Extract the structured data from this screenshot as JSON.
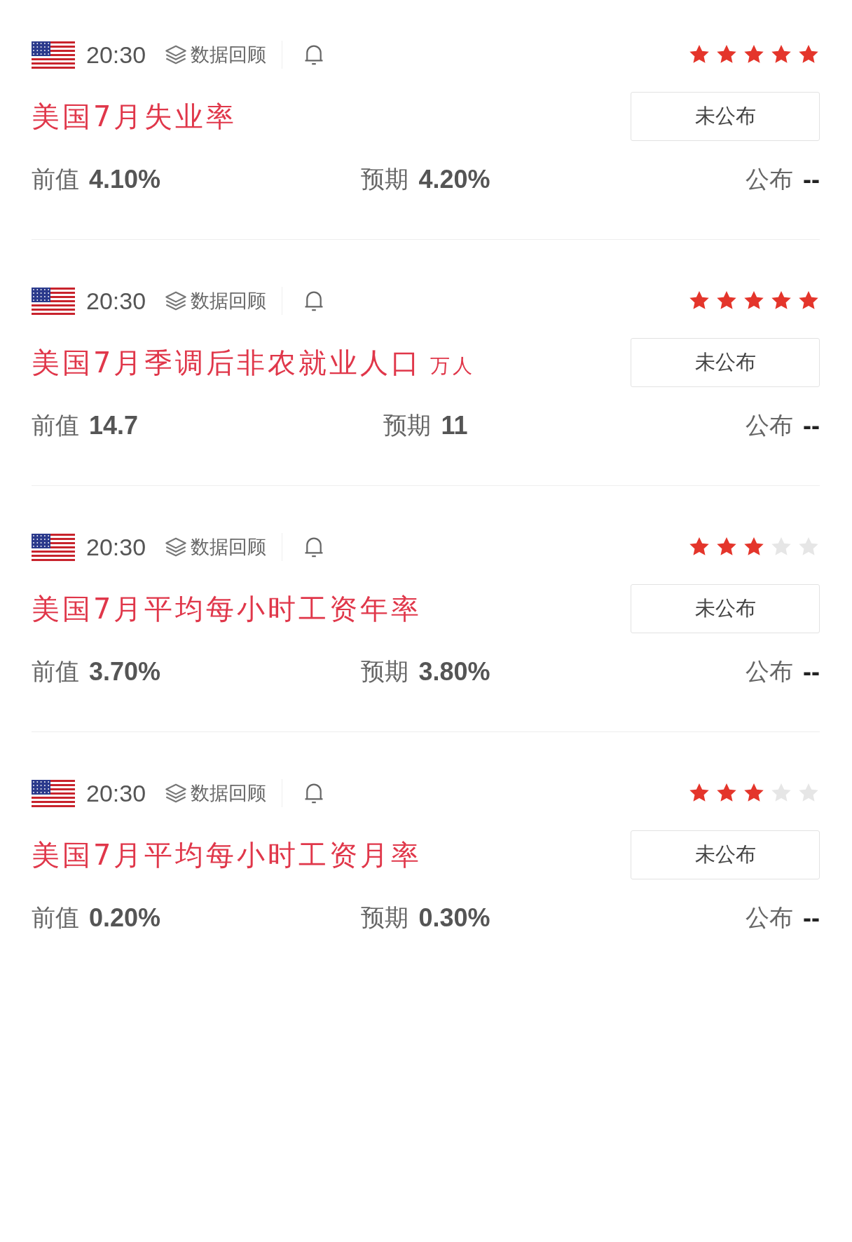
{
  "events": [
    {
      "time": "20:30",
      "review": "数据回顾",
      "stars": 5,
      "title": "美国7月失业率",
      "status": "未公布",
      "previous_label": "前值",
      "previous": "4.10%",
      "forecast_label": "预期",
      "forecast": "4.20%",
      "actual_label": "公布",
      "actual": "--"
    },
    {
      "time": "20:30",
      "review": "数据回顾",
      "stars": 5,
      "title": "美国7月季调后非农就业人口",
      "unit": "万人",
      "status": "未公布",
      "previous_label": "前值",
      "previous": "14.7",
      "forecast_label": "预期",
      "forecast": "11",
      "actual_label": "公布",
      "actual": "--"
    },
    {
      "time": "20:30",
      "review": "数据回顾",
      "stars": 3,
      "title": "美国7月平均每小时工资年率",
      "status": "未公布",
      "previous_label": "前值",
      "previous": "3.70%",
      "forecast_label": "预期",
      "forecast": "3.80%",
      "actual_label": "公布",
      "actual": "--"
    },
    {
      "time": "20:30",
      "review": "数据回顾",
      "stars": 3,
      "title": "美国7月平均每小时工资月率",
      "status": "未公布",
      "previous_label": "前值",
      "previous": "0.20%",
      "forecast_label": "预期",
      "forecast": "0.30%",
      "actual_label": "公布",
      "actual": "--"
    }
  ]
}
